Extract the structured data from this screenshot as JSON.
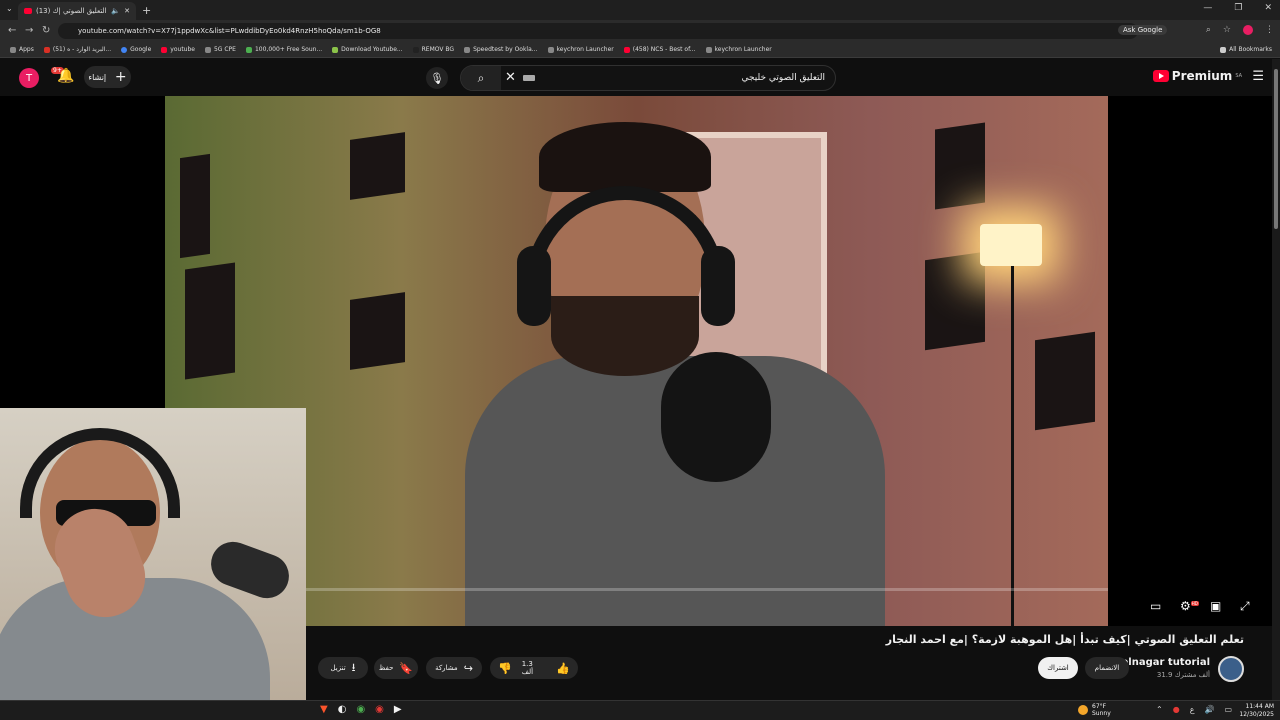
{
  "browser": {
    "tab_title": "(13) تعلم التعليق الصوتي |ك...",
    "url": "youtube.com/watch?v=X77j1ppdwXc&list=PLwddibDyEo0kd4RnzH5hoQda/sm1b-OG8",
    "ask_google": "Ask Google",
    "bookmarks": [
      "Apps",
      "(51) البريد الوارد - ه...",
      "Google",
      "youtube",
      "5G CPE",
      "100,000+ Free Soun...",
      "Download Youtube...",
      "REMOV BG",
      "Speedtest by Ookla...",
      "keychron Launcher",
      "(458) NCS - Best of...",
      "keychron Launcher"
    ],
    "all_bookmarks": "All Bookmarks"
  },
  "youtube": {
    "avatar_letter": "T",
    "notif_count": "9+",
    "create_label": "إنشاء",
    "search_value": "التعليق الصوتي خليجي",
    "logo_text": "Premium",
    "logo_region": "SA"
  },
  "video": {
    "title": "تعلم التعليق الصوتي |كيف تبدأ |هل الموهبة لازمة؟ |مع احمد النجار",
    "channel": "elnagar tutorial",
    "subscribers": "31.9 ألف مشترك",
    "join_label": "الانضمام",
    "subscribed_label": "اشتراك",
    "likes": "1.3 ألف",
    "share_label": "مشاركة",
    "save_label": "حفظ",
    "download_label": "تنزيل",
    "settings_badge": "HD"
  },
  "taskbar": {
    "temp": "67°F",
    "weather": "Sunny",
    "time": "11:44 AM",
    "date": "12/30/2025",
    "lang": "ع"
  }
}
